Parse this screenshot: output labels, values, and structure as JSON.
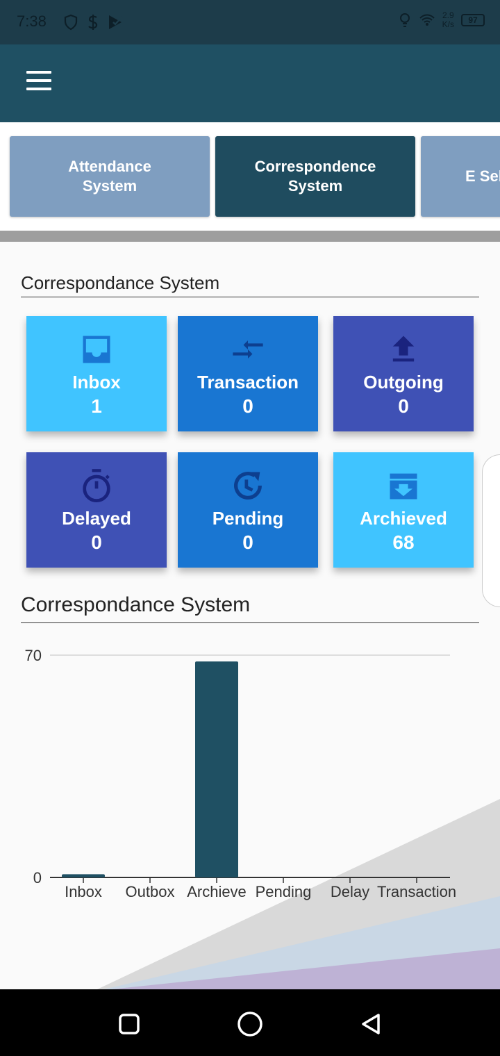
{
  "status_bar": {
    "time": "7:38",
    "net_speed_value": "2.9",
    "net_speed_unit": "K/s",
    "battery": "97"
  },
  "systems": [
    {
      "label": "Attendance System",
      "color": "#7f9ec0"
    },
    {
      "label": "Correspondence System",
      "color": "#1f4c5f"
    },
    {
      "label": "E Sel",
      "color": "#7f9ec0"
    }
  ],
  "section1_title": "Correspondance System",
  "tiles": [
    {
      "label": "Inbox",
      "count": "1",
      "color": "#40c4ff",
      "icon": "inbox-icon"
    },
    {
      "label": "Transaction",
      "count": "0",
      "color": "#1976d2",
      "icon": "compare-arrows-icon"
    },
    {
      "label": "Outgoing",
      "count": "0",
      "color": "#3f51b5",
      "icon": "upload-icon"
    },
    {
      "label": "Delayed",
      "count": "0",
      "color": "#3f51b5",
      "icon": "timer-icon"
    },
    {
      "label": "Pending",
      "count": "0",
      "color": "#1976d2",
      "icon": "history-icon"
    },
    {
      "label": "Archieved",
      "count": "68",
      "color": "#40c4ff",
      "icon": "archive-icon"
    }
  ],
  "section2_title": "Correspondance System",
  "chart_data": {
    "type": "bar",
    "categories": [
      "Inbox",
      "Outbox",
      "Archieve",
      "Pending",
      "Delay",
      "Transaction"
    ],
    "values": [
      1,
      0,
      68,
      0,
      0,
      0
    ],
    "ylim": [
      0,
      70
    ],
    "y_ticks": [
      "0",
      "70"
    ],
    "bar_color": "#1f5063",
    "grid": true
  }
}
